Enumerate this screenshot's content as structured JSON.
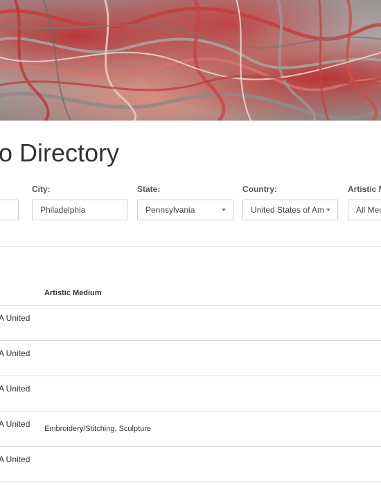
{
  "page": {
    "title_fragment": "o Directory"
  },
  "filters": {
    "city": {
      "label": "City:",
      "value": "Philadelphia"
    },
    "state": {
      "label": "State:",
      "value": "Pennsylvania"
    },
    "country": {
      "label": "Country:",
      "value": "United States of Am"
    },
    "medium": {
      "label": "Artistic M",
      "value": "All Med"
    }
  },
  "table": {
    "columns": [
      "Artistic Medium"
    ],
    "rows": [
      {
        "location_fragment": "A United",
        "medium": ""
      },
      {
        "location_fragment": "A United",
        "medium": ""
      },
      {
        "location_fragment": "A United",
        "medium": ""
      },
      {
        "location_fragment": "A United",
        "medium": "Embroidery/Stitching, Sculpture"
      },
      {
        "location_fragment": "A United",
        "medium": ""
      }
    ]
  },
  "icons": {
    "dropdown": "chevron-down-icon"
  },
  "colors": {
    "border": "#cfcfcf",
    "text": "#333333",
    "hero_red": "#b83a3a"
  }
}
